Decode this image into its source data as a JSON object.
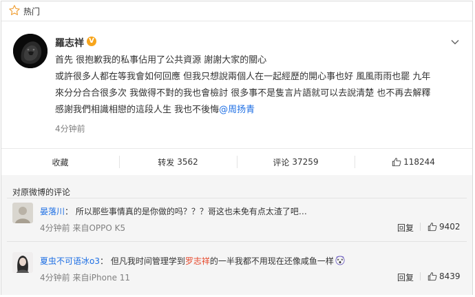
{
  "topbar": {
    "title": "热门",
    "icon": "star-icon"
  },
  "post": {
    "author": "羅志祥",
    "verified_badge": "V",
    "lines": [
      "首先 很抱歉我的私事佔用了公共資源 謝謝大家的關心",
      "或許很多人都在等我會如何回應 但我只想說兩個人在一起經歷的開心事也好 風風雨雨也罷 九年",
      "來分分合合很多次 我做得不對的我也會檢討 很多事不是隻言片語就可以去說清楚 也不再去解釋",
      "感謝我們相識相戀的這段人生 我也不後悔"
    ],
    "mention": "@周扬青",
    "time": "4分钟前"
  },
  "actions": {
    "favorite": "收藏",
    "repost_label": "转发",
    "repost_count": "3562",
    "comment_label": "评论",
    "comment_count": "37259",
    "like_count": "118244"
  },
  "comments_header": "对原微博的评论",
  "comments": [
    {
      "user": "晏落川",
      "separator": "：",
      "text": "所以那些事情真的是你做的吗？？？哥这也未免有点太渣了吧…",
      "time": "4分钟前",
      "source": "来自OPPO K5",
      "reply_label": "回复",
      "likes": "9402"
    },
    {
      "user": "夏虫不可语冰o3",
      "separator": "：",
      "text_before": "但凡我时间管理学到",
      "text_highlight": "罗志祥",
      "text_after": "的一半我都不用现在还像咸鱼一样",
      "emoji": "dizzy-face-emoji",
      "time": "4分钟前",
      "source": "来自iPhone 11",
      "reply_label": "回复",
      "likes": "8439"
    }
  ],
  "colors": {
    "link": "#1c6ee4",
    "highlight": "#e6492d",
    "badge": "#f7a51c",
    "muted": "#808080"
  }
}
